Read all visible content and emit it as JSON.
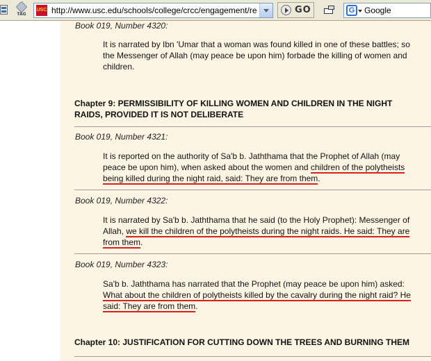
{
  "browser": {
    "tag_label": "TAG",
    "favicon_text": "USC",
    "url": "http://www.usc.edu/schools/college/crcc/engagement/resou",
    "go_label": "GO",
    "search_placeholder": "Google",
    "search_logo": "G"
  },
  "content": {
    "hadith_4320": {
      "book": "Book 019, Number 4320:",
      "text": "It is narrated by Ibn 'Umar that a woman was found killed in one of these battles; so the Messenger of Allah (may peace be upon him) forbade the killing of women and children."
    },
    "chapter_9": "Chapter 9: PERMISSIBILITY OF KILLING WOMEN AND CHILDREN IN THE NIGHT RAIDS, PROVIDED IT IS NOT DELIBERATE",
    "hadith_4321": {
      "book": "Book 019, Number 4321:",
      "text_plain": "It is reported on the authority of Sa'b b. Jaththama that the Prophet of Allah (may peace be upon him), when asked about the women and ",
      "text_underlined": "children of the polytheists being killed during the night raid, said: They are from them",
      "text_end": "."
    },
    "hadith_4322": {
      "book": "Book 019, Number 4322:",
      "text_plain": "It is narrated by Sa'b b. Jaththama that he said (to the Holy Prophet): Messenger of Allah, ",
      "text_underlined": "we kill the children of the polytheists during the night raids. He said: They are from them",
      "text_end": "."
    },
    "hadith_4323": {
      "book": "Book 019, Number 4323:",
      "text_plain": "Sa'b b. Jaththama has narrated that the Prophet (may peace be upon him) asked: ",
      "text_underlined": "What about the children of polytheists killed by the cavalry during the night raid? He said: They are from them",
      "text_end": "."
    },
    "chapter_10": "Chapter 10: JUSTIFICATION FOR CUTTING DOWN THE TREES AND BURNING THEM"
  },
  "colors": {
    "page_bg": "#fdf5e4",
    "underline": "#d8211c",
    "toolbar": "#ece9d8"
  }
}
